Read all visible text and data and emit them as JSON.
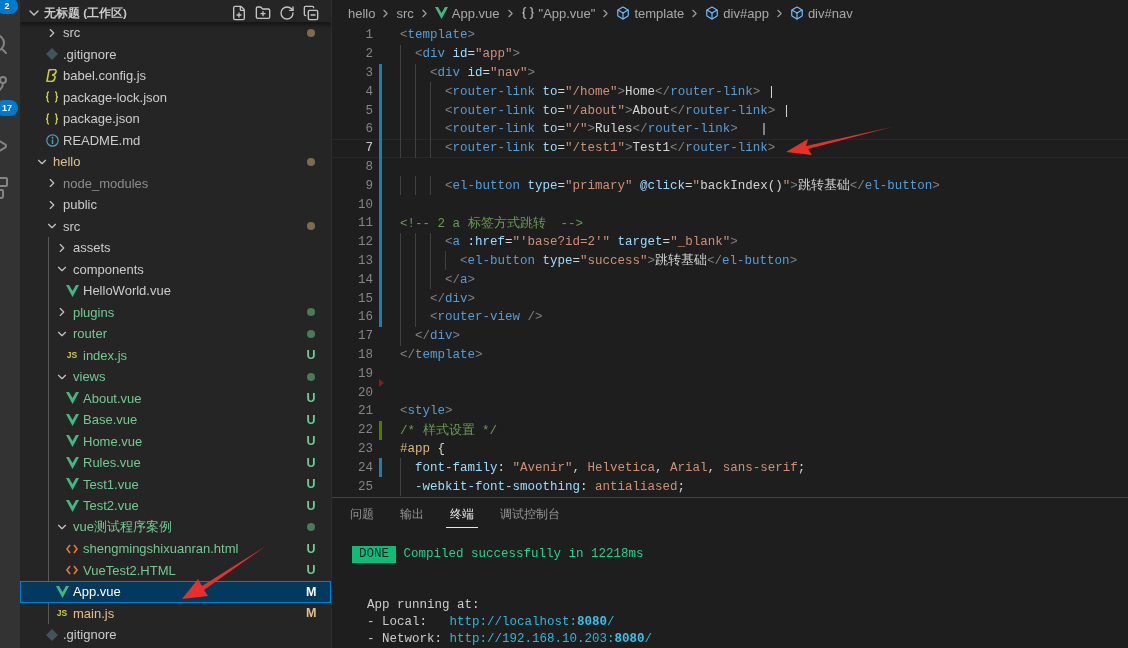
{
  "activity_bar": {
    "items": [
      {
        "kind": "files",
        "badge": "2"
      },
      {
        "kind": "search"
      },
      {
        "kind": "source-control",
        "badge": "17"
      },
      {
        "kind": "run"
      },
      {
        "kind": "extensions"
      }
    ]
  },
  "sidebar": {
    "title": "无标题 (工作区)",
    "expanded": true,
    "tree_continued": [
      {
        "name": "src",
        "kind": "folder",
        "expanded": false,
        "selected": false,
        "color": "#cccccc",
        "dot": true,
        "modified": true
      },
      {
        "name": ".gitignore",
        "kind": "git",
        "selected": false,
        "color": "#cccccc"
      },
      {
        "name": "babel.config.js",
        "kind": "babel",
        "selected": false,
        "color": "#cccccc"
      },
      {
        "name": "package-lock.json",
        "kind": "json",
        "selected": false,
        "color": "#cccccc"
      },
      {
        "name": "package.json",
        "kind": "json",
        "selected": false,
        "color": "#cccccc"
      },
      {
        "name": "README.md",
        "kind": "info",
        "selected": false,
        "color": "#cccccc"
      }
    ],
    "tree": [
      {
        "name": "hello",
        "kind": "folder",
        "expanded": true,
        "selected": false,
        "color": "#e2c08d",
        "dot": true,
        "modified": true,
        "children": [
          {
            "name": "node_modules",
            "kind": "folder",
            "expanded": false,
            "selected": false,
            "color": "#8c8c8c"
          },
          {
            "name": "public",
            "kind": "folder",
            "expanded": false,
            "selected": false,
            "color": "#cccccc"
          },
          {
            "name": "src",
            "kind": "folder",
            "expanded": true,
            "selected": false,
            "color": "#cccccc",
            "dot": true,
            "modified": true,
            "children": [
              {
                "name": "assets",
                "kind": "folder",
                "expanded": false,
                "selected": false,
                "color": "#cccccc"
              },
              {
                "name": "components",
                "kind": "folder",
                "expanded": true,
                "selected": false,
                "color": "#cccccc",
                "children": [
                  {
                    "name": "HelloWorld.vue",
                    "kind": "vue",
                    "selected": false,
                    "color": "#cccccc"
                  }
                ]
              },
              {
                "name": "plugins",
                "kind": "folder",
                "expanded": false,
                "selected": false,
                "color": "#73c991",
                "dot": true,
                "modified": false
              },
              {
                "name": "router",
                "kind": "folder",
                "expanded": true,
                "selected": false,
                "color": "#73c991",
                "dot": true,
                "modified": false,
                "children": [
                  {
                    "name": "index.js",
                    "kind": "js",
                    "icon_label": "JS",
                    "selected": false,
                    "color": "#73c991",
                    "badge": "U"
                  }
                ]
              },
              {
                "name": "views",
                "kind": "folder",
                "expanded": true,
                "selected": false,
                "color": "#73c991",
                "dot": true,
                "modified": false,
                "children": [
                  {
                    "name": "About.vue",
                    "kind": "vue",
                    "selected": false,
                    "color": "#73c991",
                    "badge": "U"
                  },
                  {
                    "name": "Base.vue",
                    "kind": "vue",
                    "selected": false,
                    "color": "#73c991",
                    "badge": "U"
                  },
                  {
                    "name": "Home.vue",
                    "kind": "vue",
                    "selected": false,
                    "color": "#73c991",
                    "badge": "U"
                  },
                  {
                    "name": "Rules.vue",
                    "kind": "vue",
                    "selected": false,
                    "color": "#73c991",
                    "badge": "U"
                  },
                  {
                    "name": "Test1.vue",
                    "kind": "vue",
                    "selected": false,
                    "color": "#73c991",
                    "badge": "U"
                  },
                  {
                    "name": "Test2.vue",
                    "kind": "vue",
                    "selected": false,
                    "color": "#73c991",
                    "badge": "U"
                  }
                ]
              },
              {
                "name": "vue测试程序案例",
                "kind": "folder",
                "expanded": true,
                "selected": false,
                "color": "#73c991",
                "dot": true,
                "modified": false,
                "children": [
                  {
                    "name": "shengmingshixuanran.html",
                    "kind": "html",
                    "selected": false,
                    "color": "#73c991",
                    "badge": "U"
                  },
                  {
                    "name": "VueTest2.HTML",
                    "kind": "html",
                    "selected": false,
                    "color": "#73c991",
                    "badge": "U"
                  }
                ]
              },
              {
                "name": "App.vue",
                "kind": "vue",
                "selected": true,
                "color": "#ffffff",
                "badge": "M"
              },
              {
                "name": "main.js",
                "kind": "js",
                "icon_label": "JS",
                "selected": false,
                "color": "#e2c08d",
                "badge": "M"
              }
            ]
          },
          {
            "name": ".gitignore",
            "kind": "git",
            "selected": false,
            "color": "#cccccc"
          }
        ]
      }
    ]
  },
  "breadcrumbs": [
    {
      "label": "hello",
      "kind": "plain"
    },
    {
      "label": "src",
      "kind": "plain"
    },
    {
      "label": "App.vue",
      "kind": "vue"
    },
    {
      "label": "\"App.vue\"",
      "kind": "braces"
    },
    {
      "label": "template",
      "kind": "element"
    },
    {
      "label": "div#app",
      "kind": "element"
    },
    {
      "label": "div#nav",
      "kind": "element"
    }
  ],
  "code_lines": [
    {
      "number": "1",
      "kind": "none",
      "current": false,
      "tokens": [
        {
          "kind": "p",
          "text": "<"
        },
        {
          "kind": "tag",
          "text": "template"
        },
        {
          "kind": "p",
          "text": ">"
        }
      ]
    },
    {
      "number": "2",
      "kind": "none",
      "current": false,
      "tokens": [
        {
          "kind": "p",
          "text": "  <"
        },
        {
          "kind": "tag",
          "text": "div"
        },
        {
          "kind": "attr",
          "text": " id"
        },
        {
          "kind": "t",
          "text": "="
        },
        {
          "kind": "s",
          "text": "\"app\""
        },
        {
          "kind": "p",
          "text": ">"
        }
      ]
    },
    {
      "number": "3",
      "kind": "modified",
      "current": false,
      "tokens": [
        {
          "kind": "p",
          "text": "    <"
        },
        {
          "kind": "tag",
          "text": "div"
        },
        {
          "kind": "attr",
          "text": " id"
        },
        {
          "kind": "t",
          "text": "="
        },
        {
          "kind": "s",
          "text": "\"nav\""
        },
        {
          "kind": "p",
          "text": ">"
        }
      ]
    },
    {
      "number": "4",
      "kind": "modified",
      "current": false,
      "tokens": [
        {
          "kind": "p",
          "text": "      <"
        },
        {
          "kind": "tag",
          "text": "router-link"
        },
        {
          "kind": "attr",
          "text": " to"
        },
        {
          "kind": "t",
          "text": "="
        },
        {
          "kind": "s",
          "text": "\"/home\""
        },
        {
          "kind": "p",
          "text": ">"
        },
        {
          "kind": "t",
          "text": "Home"
        },
        {
          "kind": "p",
          "text": "</"
        },
        {
          "kind": "tag",
          "text": "router-link"
        },
        {
          "kind": "p",
          "text": ">"
        },
        {
          "kind": "t",
          "text": " |"
        }
      ]
    },
    {
      "number": "5",
      "kind": "modified",
      "current": false,
      "tokens": [
        {
          "kind": "p",
          "text": "      <"
        },
        {
          "kind": "tag",
          "text": "router-link"
        },
        {
          "kind": "attr",
          "text": " to"
        },
        {
          "kind": "t",
          "text": "="
        },
        {
          "kind": "s",
          "text": "\"/about\""
        },
        {
          "kind": "p",
          "text": ">"
        },
        {
          "kind": "t",
          "text": "About"
        },
        {
          "kind": "p",
          "text": "</"
        },
        {
          "kind": "tag",
          "text": "router-link"
        },
        {
          "kind": "p",
          "text": ">"
        },
        {
          "kind": "t",
          "text": " |"
        }
      ]
    },
    {
      "number": "6",
      "kind": "modified",
      "current": false,
      "tokens": [
        {
          "kind": "p",
          "text": "      <"
        },
        {
          "kind": "tag",
          "text": "router-link"
        },
        {
          "kind": "attr",
          "text": " to"
        },
        {
          "kind": "t",
          "text": "="
        },
        {
          "kind": "s",
          "text": "\"/\""
        },
        {
          "kind": "p",
          "text": ">"
        },
        {
          "kind": "t",
          "text": "Rules"
        },
        {
          "kind": "p",
          "text": "</"
        },
        {
          "kind": "tag",
          "text": "router-link"
        },
        {
          "kind": "p",
          "text": ">"
        },
        {
          "kind": "t",
          "text": "   |"
        }
      ]
    },
    {
      "number": "7",
      "kind": "modified",
      "current": true,
      "tokens": [
        {
          "kind": "p",
          "text": "      <"
        },
        {
          "kind": "tag",
          "text": "router-link"
        },
        {
          "kind": "attr",
          "text": " to"
        },
        {
          "kind": "t",
          "text": "="
        },
        {
          "kind": "s",
          "text": "\"/test1\""
        },
        {
          "kind": "p",
          "text": ">"
        },
        {
          "kind": "t",
          "text": "Test1"
        },
        {
          "kind": "p",
          "text": "</"
        },
        {
          "kind": "tag",
          "text": "router-link"
        },
        {
          "kind": "p",
          "text": ">"
        }
      ]
    },
    {
      "number": "8",
      "kind": "modified",
      "current": false
    },
    {
      "number": "9",
      "kind": "modified",
      "current": false,
      "tokens": [
        {
          "kind": "p",
          "text": "      <"
        },
        {
          "kind": "tag",
          "text": "el-button"
        },
        {
          "kind": "attr",
          "text": " type"
        },
        {
          "kind": "t",
          "text": "="
        },
        {
          "kind": "s",
          "text": "\"primary\""
        },
        {
          "kind": "attr",
          "text": " @click"
        },
        {
          "kind": "t",
          "text": "="
        },
        {
          "kind": "s",
          "text": "\""
        },
        {
          "kind": "t",
          "text": "backIndex()"
        },
        {
          "kind": "s",
          "text": "\""
        },
        {
          "kind": "p",
          "text": ">"
        },
        {
          "kind": "t",
          "text": "跳转基础"
        },
        {
          "kind": "p",
          "text": "</"
        },
        {
          "kind": "tag",
          "text": "el-button"
        },
        {
          "kind": "p",
          "text": ">"
        }
      ]
    },
    {
      "number": "10",
      "kind": "modified",
      "current": false
    },
    {
      "number": "11",
      "kind": "modified",
      "current": false,
      "tokens": [
        {
          "kind": "c",
          "text": "<!-- 2 a 标签方式跳转  -->"
        }
      ]
    },
    {
      "number": "12",
      "kind": "modified",
      "current": false,
      "tokens": [
        {
          "kind": "p",
          "text": "      <"
        },
        {
          "kind": "tag",
          "text": "a"
        },
        {
          "kind": "attr",
          "text": " :href"
        },
        {
          "kind": "t",
          "text": "="
        },
        {
          "kind": "s",
          "text": "\"'base?id=2'\""
        },
        {
          "kind": "attr",
          "text": " target"
        },
        {
          "kind": "t",
          "text": "="
        },
        {
          "kind": "s",
          "text": "\"_blank\""
        },
        {
          "kind": "p",
          "text": ">"
        }
      ]
    },
    {
      "number": "13",
      "kind": "modified",
      "current": false,
      "tokens": [
        {
          "kind": "p",
          "text": "        <"
        },
        {
          "kind": "tag",
          "text": "el-button"
        },
        {
          "kind": "attr",
          "text": " type"
        },
        {
          "kind": "t",
          "text": "="
        },
        {
          "kind": "s",
          "text": "\"success\""
        },
        {
          "kind": "p",
          "text": ">"
        },
        {
          "kind": "t",
          "text": "跳转基础"
        },
        {
          "kind": "p",
          "text": "</"
        },
        {
          "kind": "tag",
          "text": "el-button"
        },
        {
          "kind": "p",
          "text": ">"
        }
      ]
    },
    {
      "number": "14",
      "kind": "modified",
      "current": false,
      "tokens": [
        {
          "kind": "p",
          "text": "      </"
        },
        {
          "kind": "tag",
          "text": "a"
        },
        {
          "kind": "p",
          "text": ">"
        }
      ]
    },
    {
      "number": "15",
      "kind": "modified",
      "current": false,
      "tokens": [
        {
          "kind": "p",
          "text": "    </"
        },
        {
          "kind": "tag",
          "text": "div"
        },
        {
          "kind": "p",
          "text": ">"
        }
      ]
    },
    {
      "number": "16",
      "kind": "modified",
      "current": false,
      "tokens": [
        {
          "kind": "p",
          "text": "    <"
        },
        {
          "kind": "tag",
          "text": "router-view"
        },
        {
          "kind": "p",
          "text": " />"
        }
      ]
    },
    {
      "number": "17",
      "kind": "none",
      "current": false,
      "tokens": [
        {
          "kind": "p",
          "text": "  </"
        },
        {
          "kind": "tag",
          "text": "div"
        },
        {
          "kind": "p",
          "text": ">"
        }
      ]
    },
    {
      "number": "18",
      "kind": "none",
      "current": false,
      "tokens": [
        {
          "kind": "p",
          "text": "</"
        },
        {
          "kind": "tag",
          "text": "template"
        },
        {
          "kind": "p",
          "text": ">"
        }
      ]
    },
    {
      "number": "19",
      "kind": "deleted",
      "current": false
    },
    {
      "number": "20",
      "kind": "none",
      "current": false
    },
    {
      "number": "21",
      "kind": "none",
      "current": false,
      "tokens": [
        {
          "kind": "p",
          "text": "<"
        },
        {
          "kind": "tag",
          "text": "style"
        },
        {
          "kind": "p",
          "text": ">"
        }
      ]
    },
    {
      "number": "22",
      "kind": "added",
      "current": false,
      "tokens": [
        {
          "kind": "c",
          "text": "/* 样式设置 */"
        }
      ]
    },
    {
      "number": "23",
      "kind": "none",
      "current": false,
      "tokens": [
        {
          "kind": "sel",
          "text": "#app"
        },
        {
          "kind": "t",
          "text": " {"
        }
      ]
    },
    {
      "number": "24",
      "kind": "modified",
      "current": false,
      "tokens": [
        {
          "kind": "prop",
          "text": "  font-family"
        },
        {
          "kind": "t",
          "text": ": "
        },
        {
          "kind": "s",
          "text": "\"Avenir\""
        },
        {
          "kind": "t",
          "text": ", "
        },
        {
          "kind": "s",
          "text": "Helvetica"
        },
        {
          "kind": "t",
          "text": ", "
        },
        {
          "kind": "s",
          "text": "Arial"
        },
        {
          "kind": "t",
          "text": ", "
        },
        {
          "kind": "s",
          "text": "sans-serif"
        },
        {
          "kind": "t",
          "text": ";"
        }
      ]
    },
    {
      "number": "25",
      "kind": "none",
      "current": false,
      "tokens": [
        {
          "kind": "prop",
          "text": "  -webkit-font-smoothing"
        },
        {
          "kind": "t",
          "text": ": "
        },
        {
          "kind": "s",
          "text": "antialiased"
        },
        {
          "kind": "t",
          "text": ";"
        }
      ]
    }
  ],
  "panel": {
    "tabs": [
      {
        "label": "问题",
        "selected": false
      },
      {
        "label": "输出",
        "selected": false
      },
      {
        "label": "终端",
        "selected": true
      },
      {
        "label": "调试控制台",
        "selected": false
      }
    ],
    "terminal_blocks": [
      [
        [
          {
            "kind": "done",
            "text": "DONE"
          },
          {
            "kind": "success",
            "text": " Compiled successfully in 12218ms"
          }
        ]
      ],
      [
        [
          {
            "kind": "text",
            "text": "  App running at:"
          }
        ],
        [
          {
            "kind": "text",
            "text": "  - Local:   "
          },
          {
            "kind": "url",
            "text": "http://localhost:"
          },
          {
            "kind": "url-strong",
            "text": "8080"
          },
          {
            "kind": "url",
            "text": "/"
          }
        ],
        [
          {
            "kind": "text",
            "text": "  - Network: "
          },
          {
            "kind": "url",
            "text": "http://192.168.10.203:"
          },
          {
            "kind": "url-strong",
            "text": "8080"
          },
          {
            "kind": "url",
            "text": "/"
          }
        ]
      ]
    ]
  }
}
